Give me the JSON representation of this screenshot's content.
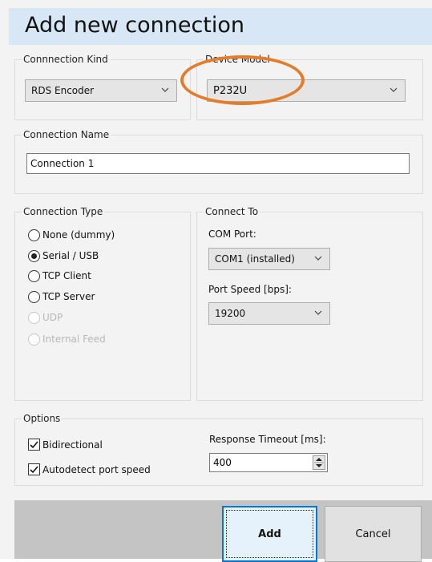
{
  "dialog": {
    "title": "Add new connection"
  },
  "connection_kind": {
    "legend": "Connnection Kind",
    "selected": "RDS Encoder"
  },
  "device_model": {
    "legend": "Device Model",
    "selected": "P232U"
  },
  "connection_name": {
    "legend": "Connection Name",
    "value": "Connection 1"
  },
  "connection_type": {
    "legend": "Connection Type",
    "options": [
      {
        "label": "None (dummy)",
        "checked": false,
        "enabled": true
      },
      {
        "label": "Serial / USB",
        "checked": true,
        "enabled": true
      },
      {
        "label": "TCP Client",
        "checked": false,
        "enabled": true
      },
      {
        "label": "TCP Server",
        "checked": false,
        "enabled": true
      },
      {
        "label": "UDP",
        "checked": false,
        "enabled": false
      },
      {
        "label": "Internal Feed",
        "checked": false,
        "enabled": false
      }
    ]
  },
  "connect_to": {
    "legend": "Connect To",
    "com_port_label": "COM Port:",
    "com_port_value": "COM1 (installed)",
    "port_speed_label": "Port Speed [bps]:",
    "port_speed_value": "19200"
  },
  "options": {
    "legend": "Options",
    "bidirectional_label": "Bidirectional",
    "bidirectional_checked": true,
    "autodetect_label": "Autodetect port speed",
    "autodetect_checked": true,
    "timeout_label": "Response Timeout [ms]:",
    "timeout_value": "400"
  },
  "buttons": {
    "add": "Add",
    "cancel": "Cancel"
  },
  "colors": {
    "accent": "#0078d7",
    "title_bg": "#d7e7f6",
    "annotation_ring": "#e57c2a",
    "footer_bg": "#c4c4c4"
  },
  "icons": {
    "dropdown": "chevron-down-icon",
    "spinner": "spin-updown-icon",
    "check": "checkmark-icon"
  }
}
